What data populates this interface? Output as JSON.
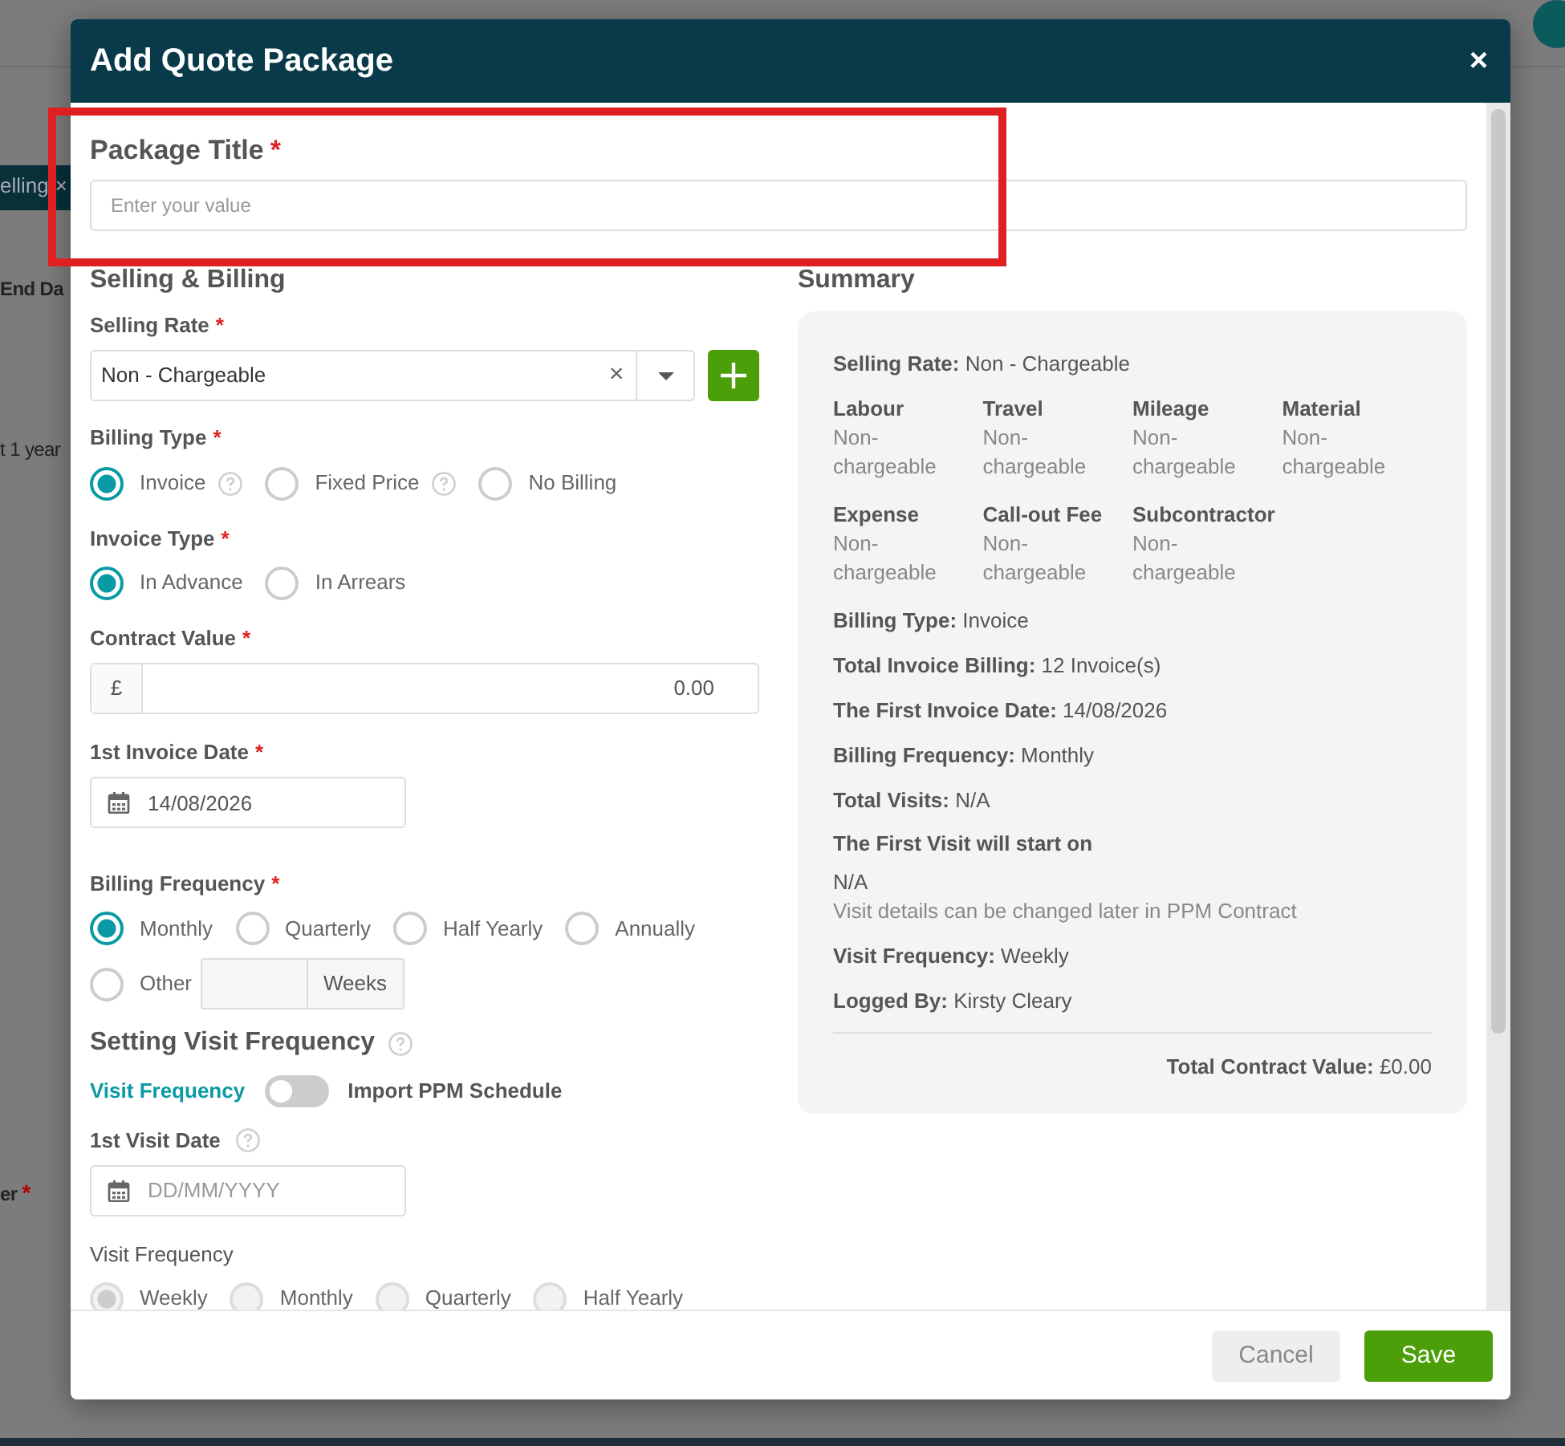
{
  "background": {
    "tag": {
      "label": "elling",
      "close": "×"
    },
    "texts": [
      {
        "text": "End Da",
        "bold": true
      },
      {
        "text": "t 1 year",
        "bold": false
      },
      {
        "text": "er",
        "bold": true,
        "mark": "*"
      }
    ]
  },
  "annotations": [
    {
      "kind": "rectangle",
      "color": "#e02020"
    }
  ],
  "modal": {
    "title": "Add Quote Package",
    "close": "×"
  },
  "package_title": {
    "label": {
      "text": "Package Title",
      "mark": "*"
    },
    "placeholder": "Enter your value"
  },
  "selling_billing": {
    "heading": "Selling & Billing",
    "selling_rate": {
      "label": {
        "text": "Selling Rate",
        "mark": "*"
      },
      "value": "Non - Chargeable",
      "clear": "×"
    },
    "billing_type": {
      "label": {
        "text": "Billing Type",
        "mark": "*"
      },
      "options": [
        {
          "label": "Invoice",
          "selected": true,
          "help": true
        },
        {
          "label": "Fixed Price",
          "selected": false,
          "help": true
        },
        {
          "label": "No Billing",
          "selected": false,
          "help": false
        }
      ]
    },
    "invoice_type": {
      "label": {
        "text": "Invoice Type",
        "mark": "*"
      },
      "options": [
        {
          "label": "In Advance",
          "selected": true,
          "help": false
        },
        {
          "label": "In Arrears",
          "selected": false,
          "help": false
        }
      ]
    },
    "contract_value": {
      "label": {
        "text": "Contract Value",
        "mark": "*"
      },
      "prefix": "£",
      "value": "0.00"
    },
    "first_invoice_date": {
      "label": {
        "text": "1st Invoice Date",
        "mark": "*"
      },
      "value": "14/08/2026"
    },
    "billing_frequency": {
      "label": {
        "text": "Billing Frequency",
        "mark": "*"
      },
      "options": [
        {
          "label": "Monthly",
          "selected": true,
          "kind": "plain"
        },
        {
          "label": "Quarterly",
          "selected": false,
          "kind": "plain"
        },
        {
          "label": "Half Yearly",
          "selected": false,
          "kind": "plain"
        },
        {
          "label": "Annually",
          "selected": false,
          "kind": "plain"
        },
        {
          "label": "Other",
          "selected": false,
          "kind": "other",
          "unit": "Weeks"
        }
      ]
    }
  },
  "visit": {
    "heading": "Setting Visit Frequency",
    "help": true,
    "toggle": {
      "left_label": "Visit Frequency",
      "on": false,
      "right_label": "Import PPM Schedule"
    },
    "first_visit_date": {
      "label": {
        "text": "1st Visit Date"
      },
      "help": true,
      "placeholder": "DD/MM/YYYY"
    },
    "visit_frequency": {
      "label": {
        "text": "Visit Frequency"
      },
      "disabled": true,
      "options": [
        {
          "label": "Weekly",
          "selected": true
        },
        {
          "label": "Monthly",
          "selected": false
        },
        {
          "label": "Quarterly",
          "selected": false
        },
        {
          "label": "Half Yearly",
          "selected": false
        }
      ]
    }
  },
  "summary": {
    "heading": "Summary",
    "items": [
      {
        "kind": "line",
        "label": "Selling Rate:",
        "value": "Non - Chargeable"
      },
      {
        "kind": "grid",
        "cells": [
          {
            "label": "Labour",
            "value": "Non-chargeable"
          },
          {
            "label": "Travel",
            "value": "Non-chargeable"
          },
          {
            "label": "Mileage",
            "value": "Non-chargeable"
          },
          {
            "label": "Material",
            "value": "Non-chargeable"
          },
          {
            "label": "Expense",
            "value": "Non-chargeable"
          },
          {
            "label": "Call-out Fee",
            "value": "Non-chargeable"
          },
          {
            "label": "Subcontractor",
            "value": "Non-chargeable"
          }
        ]
      },
      {
        "kind": "line",
        "label": "Billing Type:",
        "value": "Invoice"
      },
      {
        "kind": "line",
        "label": "Total Invoice Billing:",
        "value": "12 Invoice(s)"
      },
      {
        "kind": "line",
        "label": "The First Invoice Date:",
        "value": "14/08/2026"
      },
      {
        "kind": "line",
        "label": "Billing Frequency:",
        "value": "Monthly"
      },
      {
        "kind": "line",
        "label": "Total Visits:",
        "value": "N/A"
      },
      {
        "kind": "block",
        "label": "The First Visit will start on",
        "value": "N/A",
        "note": "Visit details can be changed later in PPM Contract"
      },
      {
        "kind": "line",
        "label": "Visit Frequency:",
        "value": "Weekly"
      },
      {
        "kind": "line",
        "label": "Logged By:",
        "value": "Kirsty Cleary"
      },
      {
        "kind": "total",
        "label": "Total Contract Value:",
        "value": "£0.00"
      }
    ]
  },
  "buttons": [
    {
      "label": "Cancel",
      "kind": "secondary"
    },
    {
      "label": "Save",
      "kind": "primary"
    }
  ]
}
